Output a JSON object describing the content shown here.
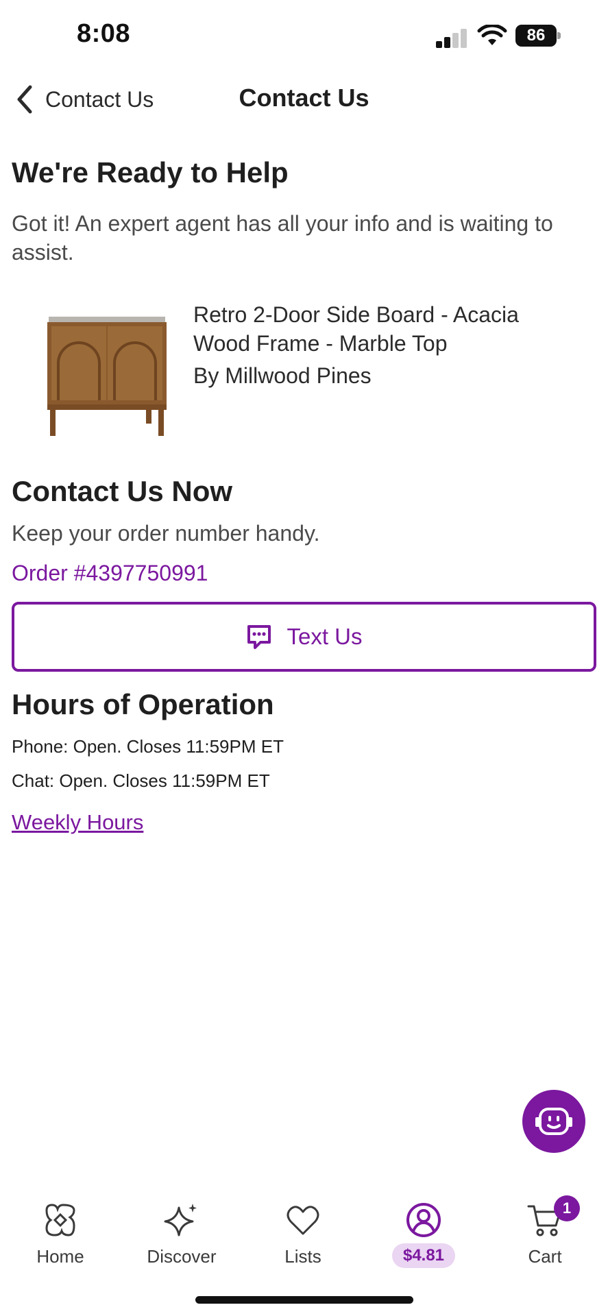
{
  "status_bar": {
    "time": "8:08",
    "battery": "86"
  },
  "header": {
    "back_label": "Contact Us",
    "title": "Contact Us"
  },
  "help": {
    "heading": "We're Ready to Help",
    "text": "Got it! An expert agent has all your info and is waiting to assist."
  },
  "product": {
    "name": "Retro 2-Door Side Board - Acacia Wood Frame - Marble Top",
    "brand": "By Millwood Pines"
  },
  "contact": {
    "heading": "Contact Us Now",
    "note": "Keep your order number handy.",
    "order": "Order #4397750991",
    "text_us_label": "Text Us"
  },
  "hours": {
    "heading": "Hours of Operation",
    "phone": "Phone:  Open. Closes 11:59PM ET",
    "chat": "Chat:  Open. Closes 11:59PM ET",
    "weekly_link": "Weekly Hours"
  },
  "tabs": [
    {
      "label": "Home",
      "icon": "home-icon"
    },
    {
      "label": "Discover",
      "icon": "sparkle-icon"
    },
    {
      "label": "Lists",
      "icon": "heart-icon"
    },
    {
      "label": "$4.81",
      "icon": "account-icon"
    },
    {
      "label": "Cart",
      "icon": "cart-icon",
      "badge": "1"
    }
  ],
  "colors": {
    "accent": "#7b189f",
    "accent_light": "#ead5f2",
    "text": "#2b2b2b"
  }
}
